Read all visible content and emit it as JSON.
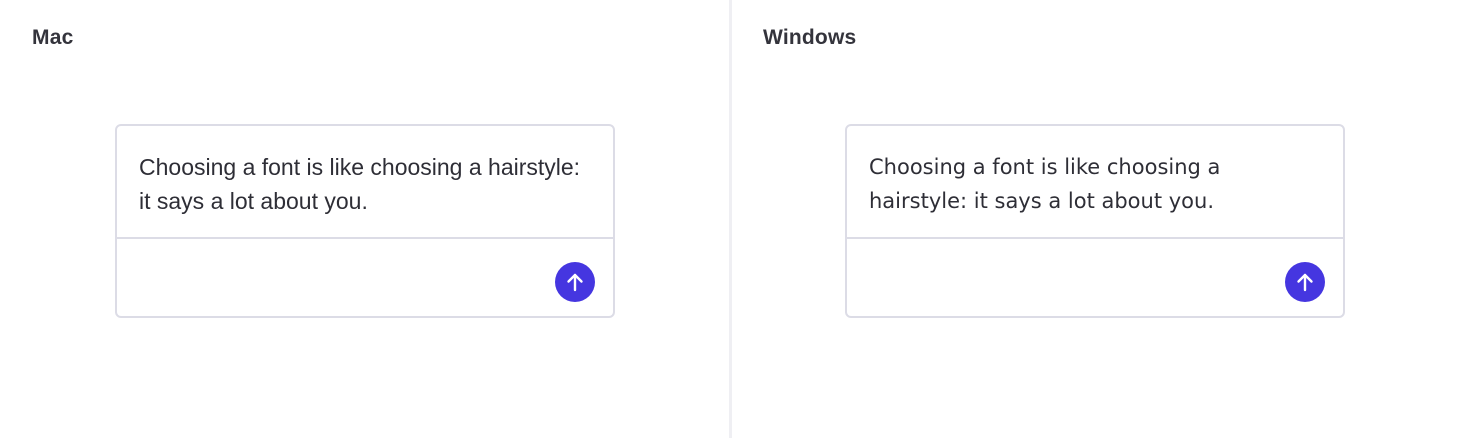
{
  "panels": [
    {
      "title": "Mac",
      "message_text": "Choosing a font is like choosing a hairstyle: it says a lot about you.",
      "send_icon": "arrow-up-icon"
    },
    {
      "title": "Windows",
      "message_text": "Choosing a font is like choosing a hairstyle: it says a lot about you.",
      "send_icon": "arrow-up-icon"
    }
  ],
  "colors": {
    "accent": "#4536e0",
    "border": "#dcdce6",
    "divider": "#efeff3",
    "text": "#2e2e36"
  }
}
